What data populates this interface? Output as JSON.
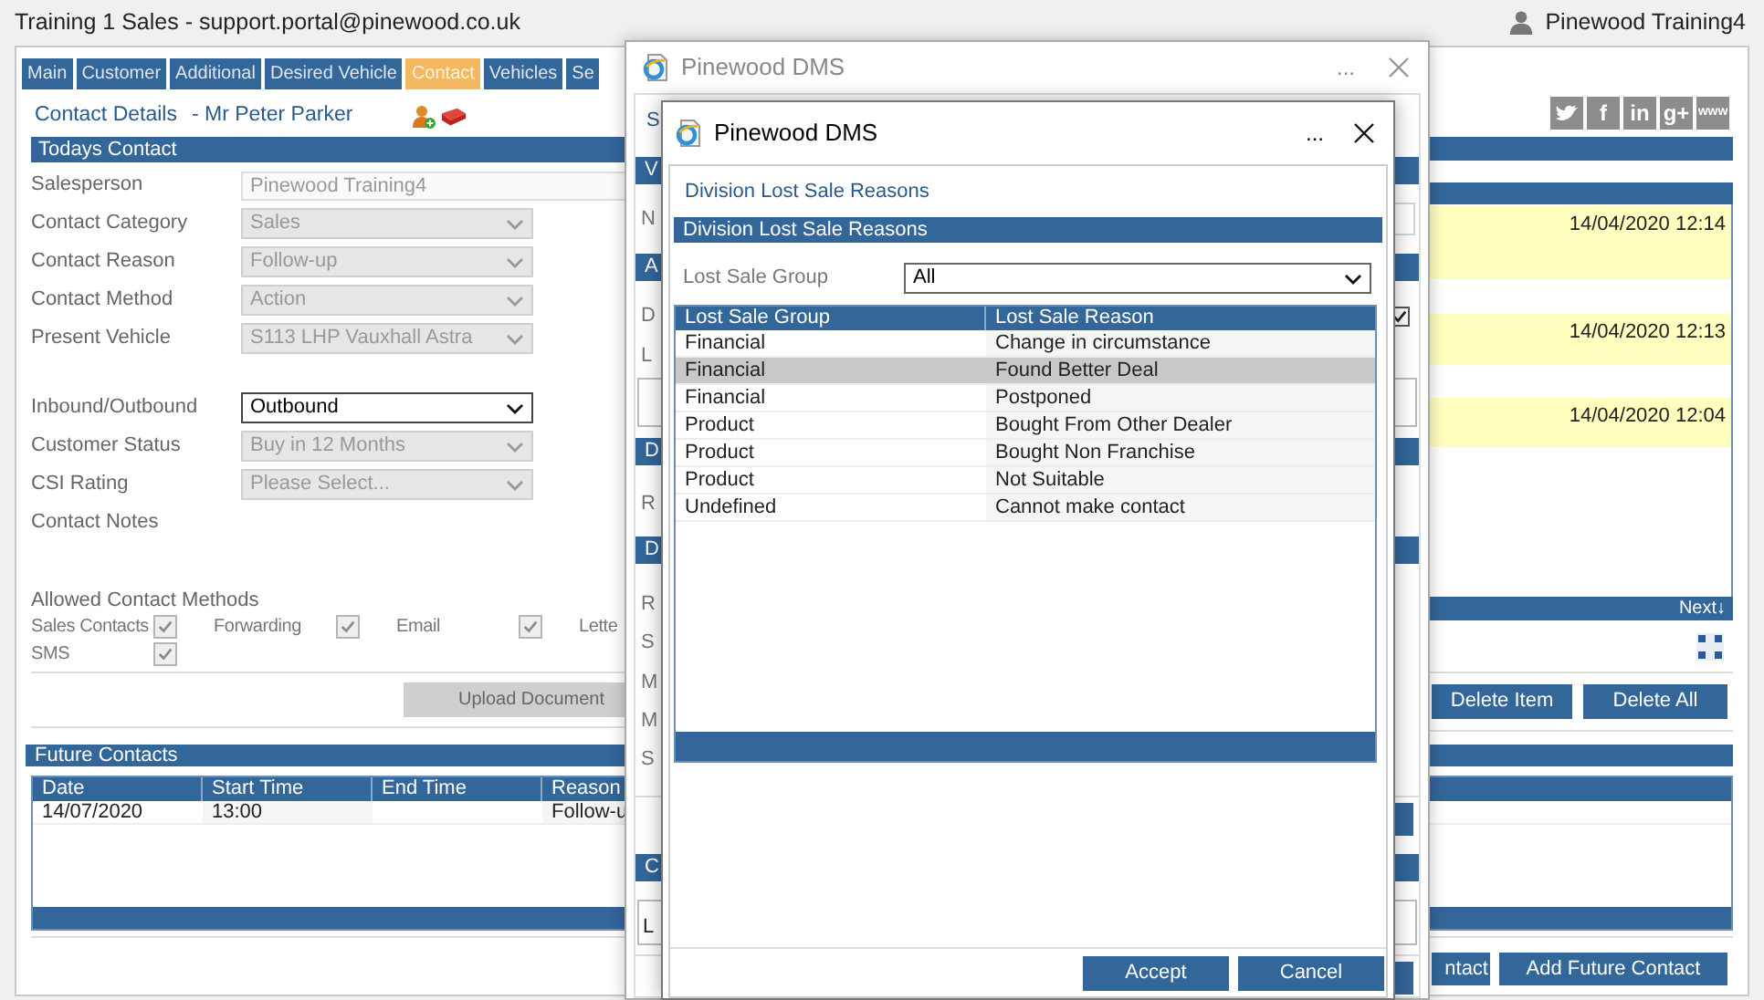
{
  "window": {
    "title": "Training 1 Sales - support.portal@pinewood.co.uk",
    "user": "Pinewood Training4"
  },
  "tabs": [
    {
      "label": "Main",
      "selected": false
    },
    {
      "label": "Customer",
      "selected": false
    },
    {
      "label": "Additional",
      "selected": false
    },
    {
      "label": "Desired Vehicle",
      "selected": false
    },
    {
      "label": "Contact",
      "selected": true
    },
    {
      "label": "Vehicles",
      "selected": false
    },
    {
      "label": "Se",
      "selected": false
    }
  ],
  "contact_details": {
    "link": "Contact Details",
    "customer": "- Mr Peter Parker"
  },
  "todays_contact": {
    "title": "Todays Contact",
    "fields": [
      {
        "label": "Salesperson",
        "kind": "input",
        "value": "Pinewood Training4",
        "disabled": true
      },
      {
        "label": "Contact Category",
        "kind": "select",
        "value": "Sales",
        "disabled": true
      },
      {
        "label": "Contact Reason",
        "kind": "select",
        "value": "Follow-up",
        "disabled": true
      },
      {
        "label": "Contact Method",
        "kind": "select",
        "value": "Action",
        "disabled": true
      },
      {
        "label": "Present Vehicle",
        "kind": "select",
        "value": "S113 LHP Vauxhall Astra",
        "disabled": true
      },
      {
        "label": "Inbound/Outbound",
        "kind": "select",
        "value": "Outbound",
        "disabled": false
      },
      {
        "label": "Customer Status",
        "kind": "select",
        "value": "Buy in 12 Months",
        "disabled": true
      },
      {
        "label": "CSI Rating",
        "kind": "select",
        "value": "Please Select...",
        "disabled": true
      },
      {
        "label": "Contact Notes",
        "kind": "label"
      }
    ]
  },
  "allowed_contact_methods": {
    "title": "Allowed Contact Methods",
    "methods": [
      {
        "label": "Sales Contacts",
        "checked": true
      },
      {
        "label": "Forwarding",
        "checked": true
      },
      {
        "label": "Email",
        "checked": true
      },
      {
        "label": "Lette"
      },
      {
        "label": "SMS",
        "checked": true
      }
    ]
  },
  "upload_button": {
    "label": "Upload Document",
    "disabled": true
  },
  "social": [
    {
      "kind": "twitter"
    },
    {
      "kind": "facebook",
      "glyph": "f"
    },
    {
      "kind": "linkedin",
      "glyph": "in"
    },
    {
      "kind": "googleplus",
      "glyph": "g+"
    },
    {
      "kind": "web",
      "glyph": "www"
    }
  ],
  "notes": {
    "items": [
      {
        "time": "14/04/2020 12:14"
      },
      {
        "time": "14/04/2020 12:13"
      },
      {
        "time": "14/04/2020 12:04"
      }
    ],
    "next": "Next↓"
  },
  "note_buttons": [
    {
      "label": "Delete Item"
    },
    {
      "label": "Delete All"
    }
  ],
  "future_contacts": {
    "title": "Future Contacts",
    "columns": [
      "Date",
      "Start Time",
      "End Time",
      "Reason"
    ],
    "rows": [
      [
        "14/07/2020",
        "13:00",
        null,
        "Follow-u"
      ]
    ]
  },
  "bottom_buttons": [
    {
      "label": "ntact"
    },
    {
      "label": "Add Future Contact"
    }
  ],
  "back_dialog": {
    "title": "Pinewood DMS",
    "menu": "...",
    "rows": [
      {
        "kind": "link",
        "text": "S"
      },
      {
        "kind": "header",
        "text": "V"
      },
      {
        "kind": "field",
        "text": "N"
      },
      {
        "kind": "header",
        "text": "A"
      },
      {
        "kind": "check",
        "text": "D",
        "checked": true
      },
      {
        "kind": "label",
        "text": "L"
      },
      {
        "kind": "box"
      },
      {
        "kind": "header",
        "text": "D"
      },
      {
        "kind": "label",
        "text": "R"
      },
      {
        "kind": "header",
        "text": "D"
      },
      {
        "kind": "label",
        "text": "R"
      },
      {
        "kind": "label",
        "text": "S"
      },
      {
        "kind": "label",
        "text": "M"
      },
      {
        "kind": "label",
        "text": "M"
      },
      {
        "kind": "label",
        "text": "S"
      },
      {
        "kind": "button"
      },
      {
        "kind": "header",
        "text": "C"
      },
      {
        "kind": "box",
        "text": "L"
      },
      {
        "kind": "button"
      }
    ]
  },
  "dialog": {
    "title": "Pinewood DMS",
    "menu": "...",
    "heading": "Division Lost Sale Reasons",
    "section": "Division Lost Sale Reasons",
    "filter": {
      "label": "Lost Sale Group",
      "value": "All"
    },
    "columns": [
      "Lost Sale Group",
      "Lost Sale Reason"
    ],
    "rows": [
      {
        "group": "Financial",
        "reason": "Change in circumstance",
        "selected": false
      },
      {
        "group": "Financial",
        "reason": "Found Better Deal",
        "selected": true
      },
      {
        "group": "Financial",
        "reason": "Postponed",
        "selected": false
      },
      {
        "group": "Product",
        "reason": "Bought From Other Dealer",
        "selected": false
      },
      {
        "group": "Product",
        "reason": "Bought Non Franchise",
        "selected": false
      },
      {
        "group": "Product",
        "reason": "Not Suitable",
        "selected": false
      },
      {
        "group": "Undefined",
        "reason": "Cannot make contact",
        "selected": false
      }
    ],
    "buttons": [
      {
        "label": "Accept"
      },
      {
        "label": "Cancel"
      }
    ]
  }
}
